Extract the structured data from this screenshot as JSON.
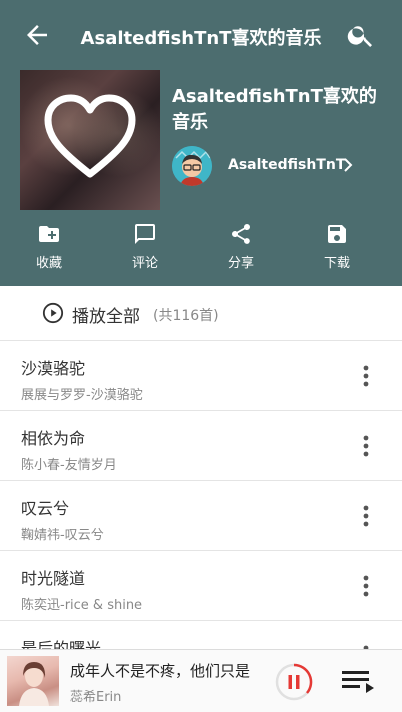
{
  "header": {
    "title": "AsaltedfishTnT喜欢的音乐",
    "playlist_title": "AsaltedfishTnT喜欢的音乐",
    "creator": "AsaltedfishTnT",
    "colors": {
      "background": "#4c6d6f"
    }
  },
  "actions": [
    {
      "label": "收藏",
      "icon": "folder-add-icon"
    },
    {
      "label": "评论",
      "icon": "comment-icon"
    },
    {
      "label": "分享",
      "icon": "share-icon"
    },
    {
      "label": "下载",
      "icon": "save-icon"
    }
  ],
  "play_all": {
    "label": "播放全部",
    "count": "(共116首)"
  },
  "songs": [
    {
      "name": "沙漠骆驼",
      "sub": "展展与罗罗-沙漠骆驼"
    },
    {
      "name": "相依为命",
      "sub": "陈小春-友情岁月"
    },
    {
      "name": "叹云兮",
      "sub": "鞠婧祎-叹云兮"
    },
    {
      "name": "时光隧道",
      "sub": "陈奕迅-rice & shine"
    },
    {
      "name": "最后的曙光",
      "sub": ""
    }
  ],
  "player": {
    "title": "成年人不是不疼，他们只是",
    "artist": "蕊希Erin",
    "accent": "#e53935"
  }
}
